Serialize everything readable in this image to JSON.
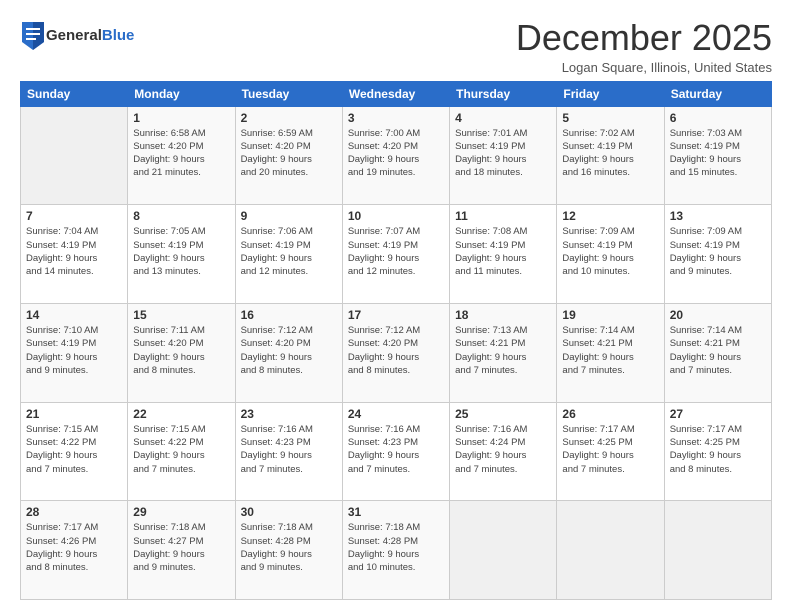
{
  "header": {
    "logo_general": "General",
    "logo_blue": "Blue",
    "title": "December 2025",
    "location": "Logan Square, Illinois, United States"
  },
  "days_of_week": [
    "Sunday",
    "Monday",
    "Tuesday",
    "Wednesday",
    "Thursday",
    "Friday",
    "Saturday"
  ],
  "weeks": [
    [
      {
        "day": "",
        "info": ""
      },
      {
        "day": "1",
        "info": "Sunrise: 6:58 AM\nSunset: 4:20 PM\nDaylight: 9 hours\nand 21 minutes."
      },
      {
        "day": "2",
        "info": "Sunrise: 6:59 AM\nSunset: 4:20 PM\nDaylight: 9 hours\nand 20 minutes."
      },
      {
        "day": "3",
        "info": "Sunrise: 7:00 AM\nSunset: 4:20 PM\nDaylight: 9 hours\nand 19 minutes."
      },
      {
        "day": "4",
        "info": "Sunrise: 7:01 AM\nSunset: 4:19 PM\nDaylight: 9 hours\nand 18 minutes."
      },
      {
        "day": "5",
        "info": "Sunrise: 7:02 AM\nSunset: 4:19 PM\nDaylight: 9 hours\nand 16 minutes."
      },
      {
        "day": "6",
        "info": "Sunrise: 7:03 AM\nSunset: 4:19 PM\nDaylight: 9 hours\nand 15 minutes."
      }
    ],
    [
      {
        "day": "7",
        "info": "Sunrise: 7:04 AM\nSunset: 4:19 PM\nDaylight: 9 hours\nand 14 minutes."
      },
      {
        "day": "8",
        "info": "Sunrise: 7:05 AM\nSunset: 4:19 PM\nDaylight: 9 hours\nand 13 minutes."
      },
      {
        "day": "9",
        "info": "Sunrise: 7:06 AM\nSunset: 4:19 PM\nDaylight: 9 hours\nand 12 minutes."
      },
      {
        "day": "10",
        "info": "Sunrise: 7:07 AM\nSunset: 4:19 PM\nDaylight: 9 hours\nand 12 minutes."
      },
      {
        "day": "11",
        "info": "Sunrise: 7:08 AM\nSunset: 4:19 PM\nDaylight: 9 hours\nand 11 minutes."
      },
      {
        "day": "12",
        "info": "Sunrise: 7:09 AM\nSunset: 4:19 PM\nDaylight: 9 hours\nand 10 minutes."
      },
      {
        "day": "13",
        "info": "Sunrise: 7:09 AM\nSunset: 4:19 PM\nDaylight: 9 hours\nand 9 minutes."
      }
    ],
    [
      {
        "day": "14",
        "info": "Sunrise: 7:10 AM\nSunset: 4:19 PM\nDaylight: 9 hours\nand 9 minutes."
      },
      {
        "day": "15",
        "info": "Sunrise: 7:11 AM\nSunset: 4:20 PM\nDaylight: 9 hours\nand 8 minutes."
      },
      {
        "day": "16",
        "info": "Sunrise: 7:12 AM\nSunset: 4:20 PM\nDaylight: 9 hours\nand 8 minutes."
      },
      {
        "day": "17",
        "info": "Sunrise: 7:12 AM\nSunset: 4:20 PM\nDaylight: 9 hours\nand 8 minutes."
      },
      {
        "day": "18",
        "info": "Sunrise: 7:13 AM\nSunset: 4:21 PM\nDaylight: 9 hours\nand 7 minutes."
      },
      {
        "day": "19",
        "info": "Sunrise: 7:14 AM\nSunset: 4:21 PM\nDaylight: 9 hours\nand 7 minutes."
      },
      {
        "day": "20",
        "info": "Sunrise: 7:14 AM\nSunset: 4:21 PM\nDaylight: 9 hours\nand 7 minutes."
      }
    ],
    [
      {
        "day": "21",
        "info": "Sunrise: 7:15 AM\nSunset: 4:22 PM\nDaylight: 9 hours\nand 7 minutes."
      },
      {
        "day": "22",
        "info": "Sunrise: 7:15 AM\nSunset: 4:22 PM\nDaylight: 9 hours\nand 7 minutes."
      },
      {
        "day": "23",
        "info": "Sunrise: 7:16 AM\nSunset: 4:23 PM\nDaylight: 9 hours\nand 7 minutes."
      },
      {
        "day": "24",
        "info": "Sunrise: 7:16 AM\nSunset: 4:23 PM\nDaylight: 9 hours\nand 7 minutes."
      },
      {
        "day": "25",
        "info": "Sunrise: 7:16 AM\nSunset: 4:24 PM\nDaylight: 9 hours\nand 7 minutes."
      },
      {
        "day": "26",
        "info": "Sunrise: 7:17 AM\nSunset: 4:25 PM\nDaylight: 9 hours\nand 7 minutes."
      },
      {
        "day": "27",
        "info": "Sunrise: 7:17 AM\nSunset: 4:25 PM\nDaylight: 9 hours\nand 8 minutes."
      }
    ],
    [
      {
        "day": "28",
        "info": "Sunrise: 7:17 AM\nSunset: 4:26 PM\nDaylight: 9 hours\nand 8 minutes."
      },
      {
        "day": "29",
        "info": "Sunrise: 7:18 AM\nSunset: 4:27 PM\nDaylight: 9 hours\nand 9 minutes."
      },
      {
        "day": "30",
        "info": "Sunrise: 7:18 AM\nSunset: 4:28 PM\nDaylight: 9 hours\nand 9 minutes."
      },
      {
        "day": "31",
        "info": "Sunrise: 7:18 AM\nSunset: 4:28 PM\nDaylight: 9 hours\nand 10 minutes."
      },
      {
        "day": "",
        "info": ""
      },
      {
        "day": "",
        "info": ""
      },
      {
        "day": "",
        "info": ""
      }
    ]
  ]
}
